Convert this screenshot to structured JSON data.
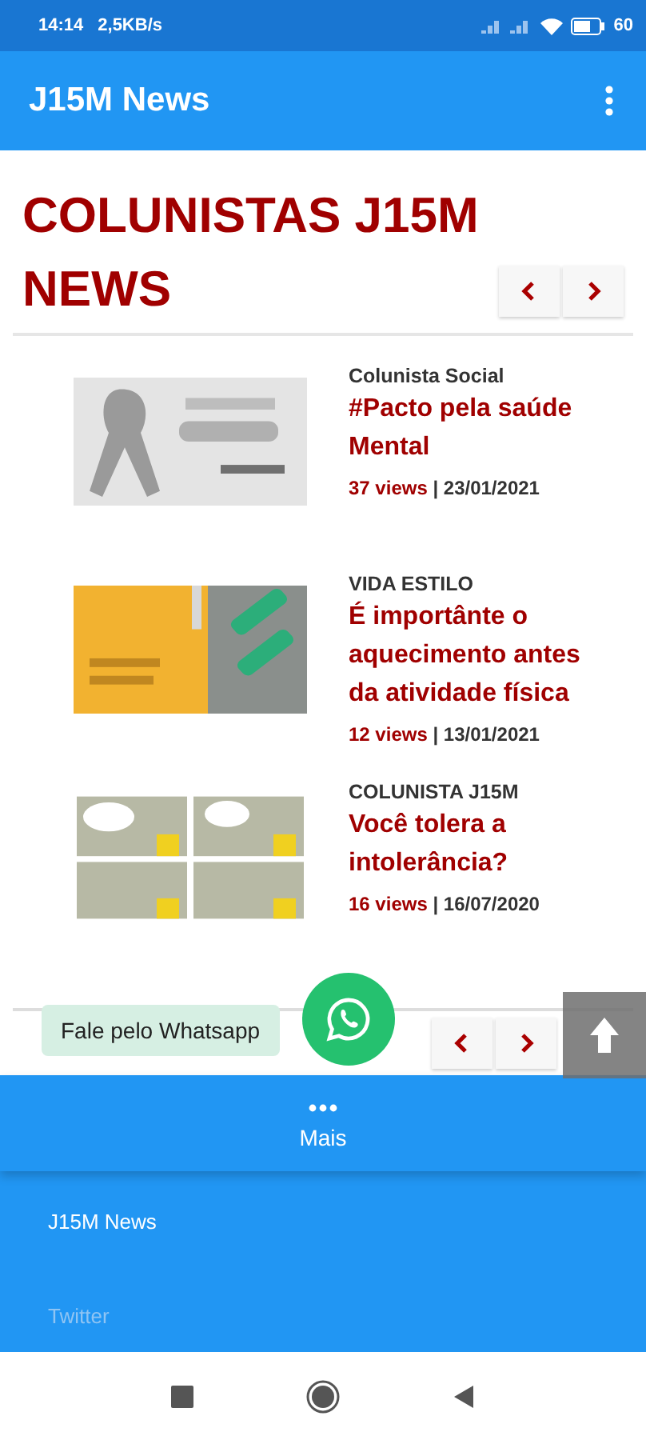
{
  "status_bar": {
    "time": "14:14",
    "speed": "2,5KB/s",
    "battery": "60"
  },
  "app_bar": {
    "title": "J15M News"
  },
  "section": {
    "title": "COLUNISTAS J15M NEWS"
  },
  "articles": [
    {
      "category": "Colunista Social",
      "title": "#Pacto pela saúde Mental",
      "views": "37 views",
      "separator": "|",
      "date": "23/01/2021"
    },
    {
      "category": "VIDA ESTILO",
      "title": "É importânte o aquecimento antes da atividade física",
      "views": "12 views",
      "separator": "|",
      "date": "13/01/2021"
    },
    {
      "category": "COLUNISTA J15M",
      "title": "Você tolera a intolerância?",
      "views": "16 views",
      "separator": "|",
      "date": "16/07/2020"
    }
  ],
  "whatsapp": {
    "label": "Fale pelo Whatsapp"
  },
  "bottom_tab": {
    "label": "Mais"
  },
  "menu": [
    {
      "label": "J15M News",
      "faded": false
    },
    {
      "label": "Twitter",
      "faded": true
    }
  ]
}
